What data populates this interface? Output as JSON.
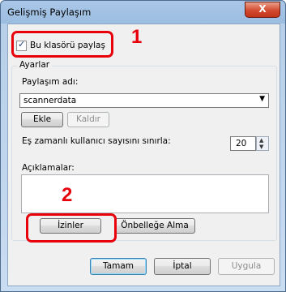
{
  "window": {
    "title": "Gelişmiş Paylaşım",
    "close_glyph": "X"
  },
  "share": {
    "checkbox_label": "Bu klasörü paylaş",
    "checked": true
  },
  "settings": {
    "group_title": "Ayarlar",
    "share_name_label": "Paylaşım adı:",
    "share_name_value": "scannerdata",
    "add_label": "Ekle",
    "remove_label": "Kaldır",
    "limit_label": "Eş zamanlı kullanıcı sayısını sınırla:",
    "limit_value": "20",
    "comments_label": "Açıklamalar:",
    "comments_value": "",
    "permissions_label": "İzinler",
    "caching_label": "Önbelleğe Alma"
  },
  "footer": {
    "ok_label": "Tamam",
    "cancel_label": "İptal",
    "apply_label": "Uygula"
  },
  "annotations": {
    "callout_1": "1",
    "callout_2": "2",
    "color": "#e8000b"
  }
}
